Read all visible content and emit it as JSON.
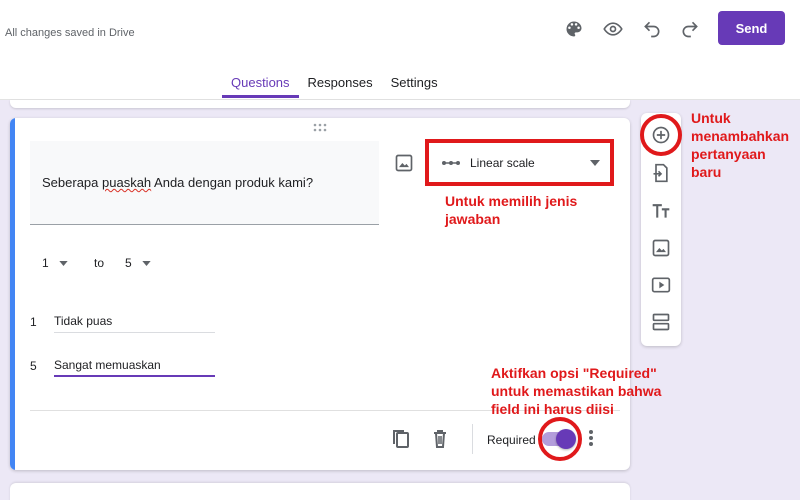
{
  "header": {
    "saved_status": "All changes saved in Drive",
    "icons": [
      "palette-icon",
      "eye-icon",
      "undo-icon",
      "redo-icon"
    ],
    "send_label": "Send"
  },
  "tabs": [
    {
      "label": "Questions",
      "active": true
    },
    {
      "label": "Responses",
      "active": false
    },
    {
      "label": "Settings",
      "active": false
    }
  ],
  "question": {
    "text_before": "Seberapa ",
    "text_misspelled": "puaskah",
    "text_after": " Anda dengan produk kami?",
    "type_label": "Linear scale",
    "scale_min": "1",
    "scale_to": "to",
    "scale_max": "5",
    "labels": [
      {
        "num": "1",
        "text": "Tidak puas"
      },
      {
        "num": "5",
        "text": "Sangat memuaskan"
      }
    ],
    "required_label": "Required",
    "required": true
  },
  "toolbar": {
    "items": [
      "add-question-icon",
      "import-questions-icon",
      "add-title-icon",
      "add-image-icon",
      "add-video-icon",
      "add-section-icon"
    ]
  },
  "annotations": {
    "type_note": "Untuk memilih jenis jawaban",
    "add_note": "Untuk menambahkan pertanyaan baru",
    "required_note": "Aktifkan opsi \"Required\" untuk memastikan bahwa field ini harus diisi"
  },
  "colors": {
    "accent": "#673ab7",
    "annotation": "#e0191b",
    "card_accent": "#4285f4",
    "canvas": "#ece8f6"
  }
}
